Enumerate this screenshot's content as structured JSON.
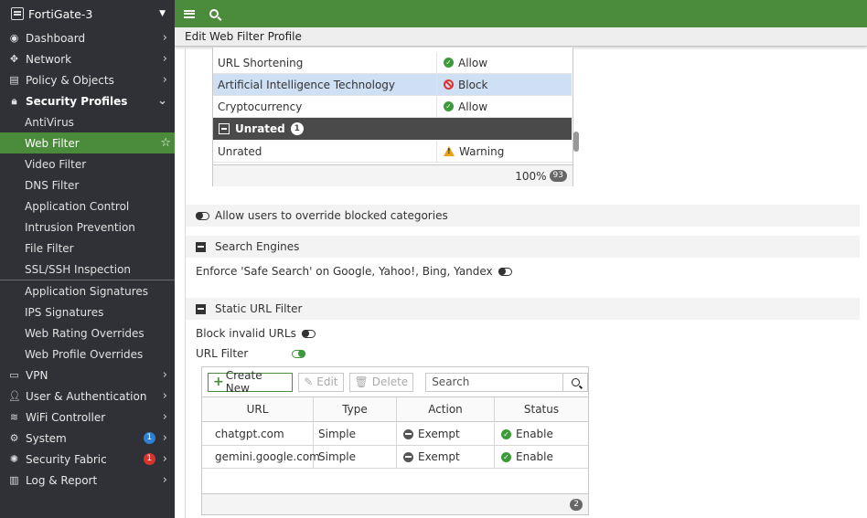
{
  "sidebar": {
    "device_name": "FortiGate-3",
    "items": [
      {
        "label": "Dashboard",
        "icon": "dashboard-icon"
      },
      {
        "label": "Network",
        "icon": "network-icon"
      },
      {
        "label": "Policy & Objects",
        "icon": "policy-icon"
      },
      {
        "label": "Security Profiles",
        "icon": "lock-icon"
      }
    ],
    "security_profiles_sub": [
      "AntiVirus",
      "Web Filter",
      "Video Filter",
      "DNS Filter",
      "Application Control",
      "Intrusion Prevention",
      "File Filter",
      "SSL/SSH Inspection"
    ],
    "security_profiles_sub2": [
      "Application Signatures",
      "IPS Signatures",
      "Web Rating Overrides",
      "Web Profile Overrides"
    ],
    "items_bottom": [
      {
        "label": "VPN",
        "icon": "vpn-icon"
      },
      {
        "label": "User & Authentication",
        "icon": "user-icon"
      },
      {
        "label": "WiFi Controller",
        "icon": "wifi-icon"
      },
      {
        "label": "System",
        "icon": "gear-icon",
        "badge": "1"
      },
      {
        "label": "Security Fabric",
        "icon": "fabric-icon",
        "badge": "1"
      },
      {
        "label": "Log & Report",
        "icon": "chart-icon"
      }
    ]
  },
  "colors": {
    "accent": "#4b8c3c",
    "sidebar_bg": "#2f3136",
    "badge_blue": "#2f7fd2",
    "badge_red": "#d8332d"
  },
  "page_title": "Edit Web Filter Profile",
  "categories": {
    "rows": [
      {
        "name": "URL Shortening",
        "action": "Allow"
      },
      {
        "name": "Artificial Intelligence Technology",
        "action": "Block"
      },
      {
        "name": "Cryptocurrency",
        "action": "Allow"
      }
    ],
    "group": {
      "name": "Unrated",
      "count": "1"
    },
    "group_rows": [
      {
        "name": "Unrated",
        "action": "Warning"
      }
    ],
    "footer_pct": "100%",
    "footer_count": "93"
  },
  "override_label": "Allow users to override blocked categories",
  "search_engines": {
    "title": "Search Engines",
    "safe_search_label": "Enforce 'Safe Search' on Google, Yahoo!, Bing, Yandex"
  },
  "static_url": {
    "title": "Static URL Filter",
    "block_invalid_label": "Block invalid URLs",
    "url_filter_label": "URL Filter",
    "toolbar": {
      "create": "Create New",
      "edit": "Edit",
      "delete": "Delete",
      "search_placeholder": "Search"
    },
    "columns": [
      "URL",
      "Type",
      "Action",
      "Status"
    ],
    "rows": [
      {
        "url": "chatgpt.com",
        "type": "Simple",
        "action": "Exempt",
        "status": "Enable"
      },
      {
        "url": "gemini.google.com",
        "type": "Simple",
        "action": "Exempt",
        "status": "Enable"
      }
    ],
    "count": "2"
  }
}
